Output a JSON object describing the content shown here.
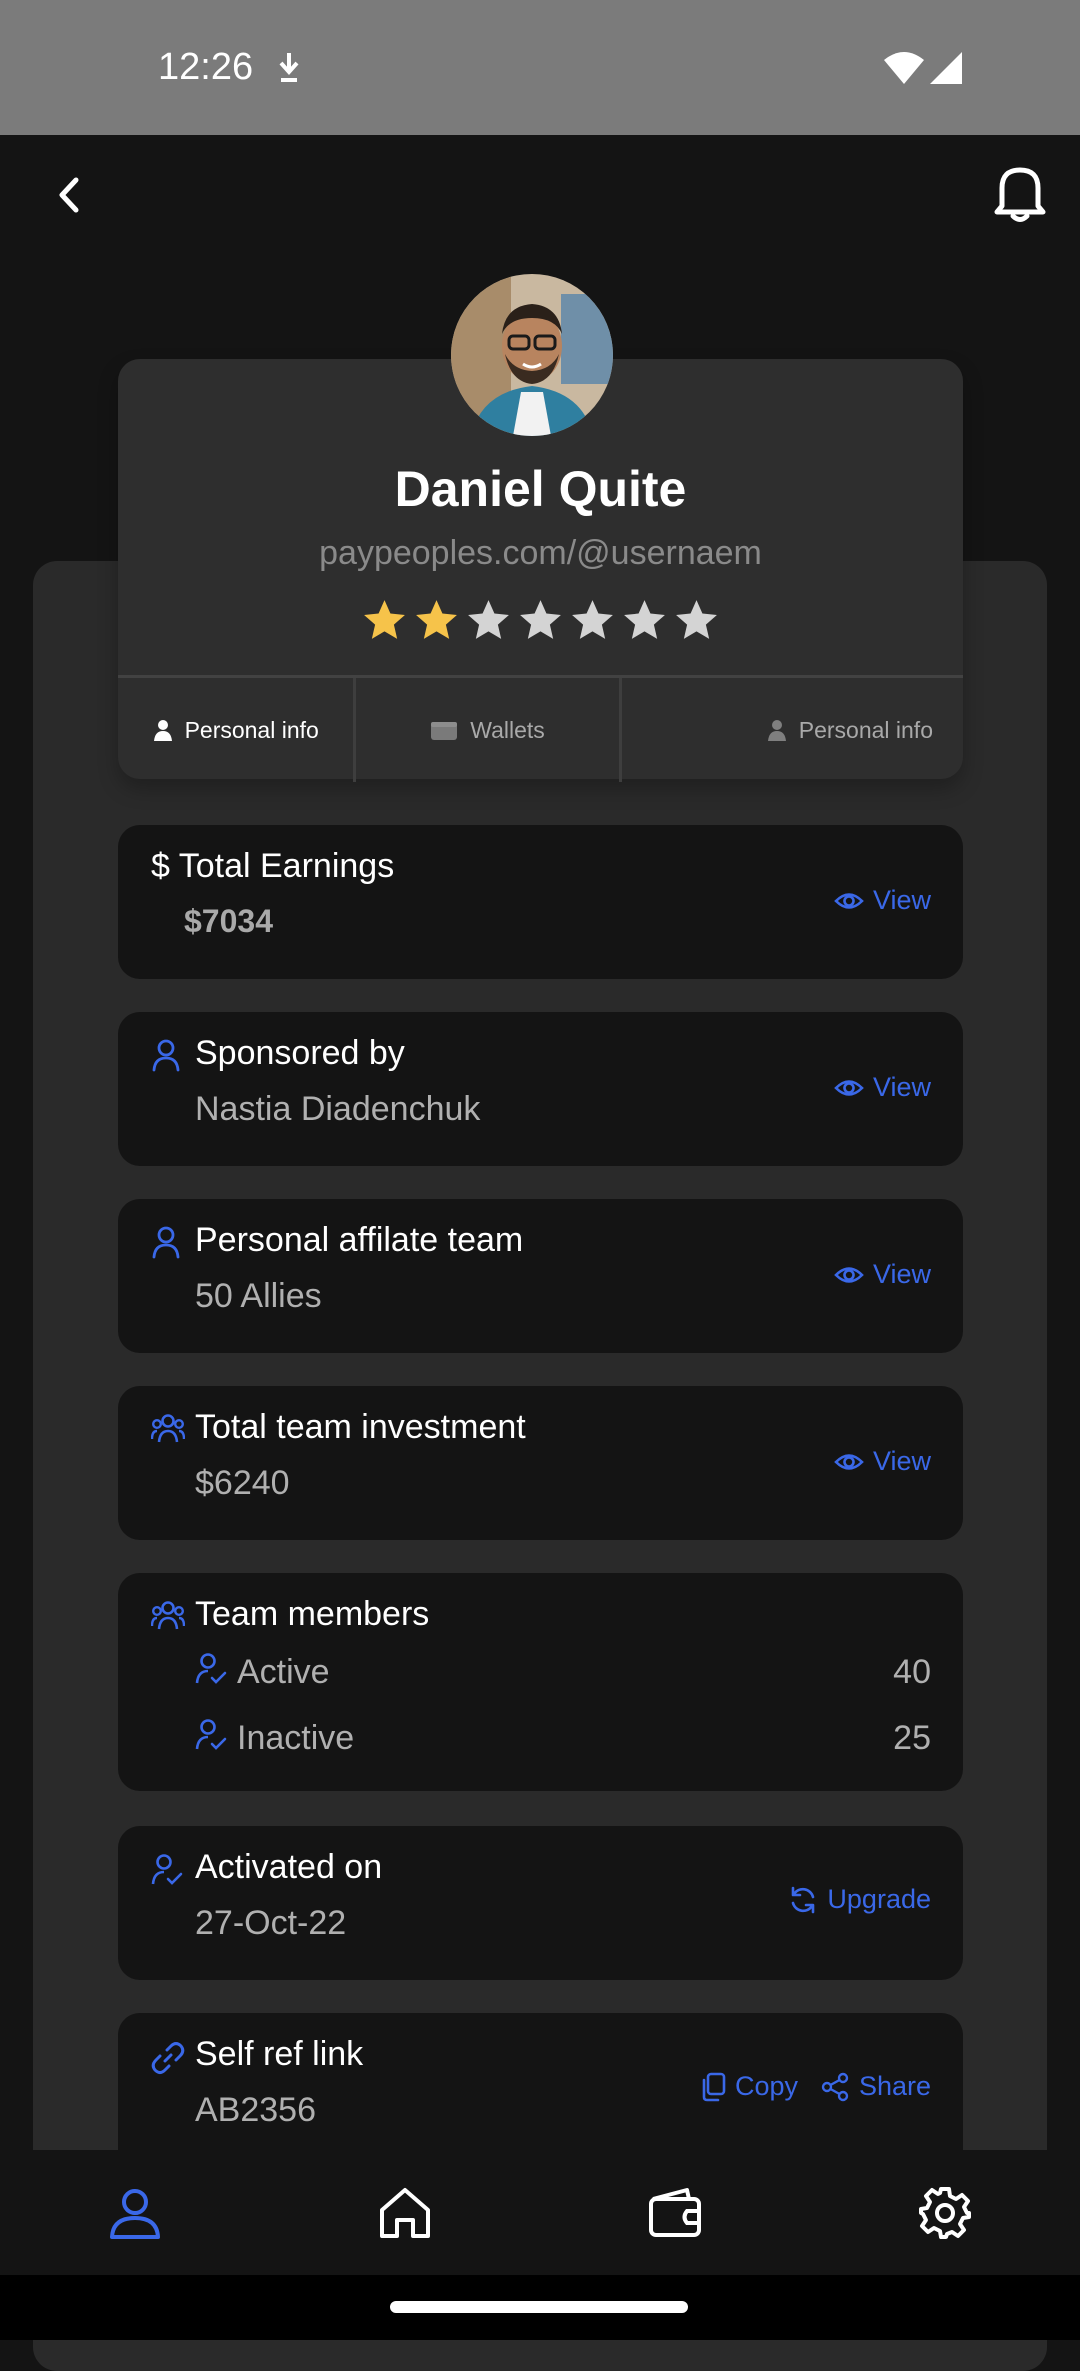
{
  "status_bar": {
    "time": "12:26"
  },
  "header": {
    "back_icon": "chevron-left-icon",
    "notification_icon": "bell-icon"
  },
  "profile": {
    "name": "Daniel Quite",
    "handle": "paypeoples.com/@usernaem",
    "rating": {
      "filled": 2,
      "total": 7
    },
    "tabs": [
      {
        "label": "Personal info",
        "icon": "user-icon",
        "active": true
      },
      {
        "label": "Wallets",
        "icon": "wallet-icon",
        "active": false
      },
      {
        "label": "Personal info",
        "icon": "user-icon",
        "active": false
      }
    ]
  },
  "cards": {
    "earnings": {
      "title": "$ Total Earnings",
      "value": "$7034",
      "action": "View"
    },
    "sponsor": {
      "title": "Sponsored by",
      "value": "Nastia Diadenchuk",
      "action": "View"
    },
    "affiliate": {
      "title": "Personal affilate team",
      "value": "50 Allies",
      "action": "View"
    },
    "investment": {
      "title": "Total team investment",
      "value": "$6240",
      "action": "View"
    },
    "members": {
      "title": "Team members",
      "active_label": "Active",
      "active_count": "40",
      "inactive_label": "Inactive",
      "inactive_count": "25"
    },
    "activated": {
      "title": "Activated on",
      "value": "27-Oct-22",
      "action": "Upgrade"
    },
    "reflink": {
      "title": "Self ref link",
      "value": "AB2356",
      "copy": "Copy",
      "share": "Share"
    }
  },
  "bottom_nav": [
    {
      "icon": "user-icon",
      "active": true
    },
    {
      "icon": "home-icon",
      "active": false
    },
    {
      "icon": "wallet-icon",
      "active": false
    },
    {
      "icon": "gear-icon",
      "active": false
    }
  ],
  "colors": {
    "accent": "#3a68e8",
    "background": "#141414",
    "panel": "#2a2a2a",
    "star_filled": "#f6c34a",
    "star_empty": "#d4d4d4"
  }
}
